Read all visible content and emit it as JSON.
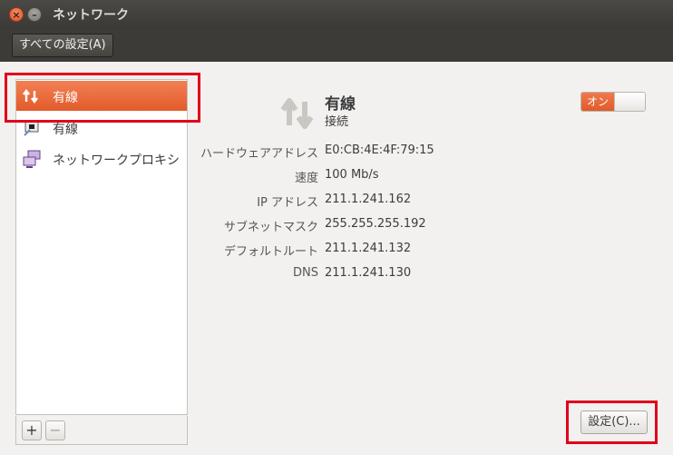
{
  "window": {
    "title": "ネットワーク",
    "close_glyph": "×",
    "minimize_glyph": "–"
  },
  "toolbar": {
    "all_settings_label": "すべての設定(A)"
  },
  "sidebar": {
    "items": [
      {
        "label": "有線",
        "icon": "wired-network-icon",
        "selected": true
      },
      {
        "label": "有線",
        "icon": "wired-adapter-icon",
        "selected": false
      },
      {
        "label": "ネットワークプロキシ",
        "icon": "network-proxy-icon",
        "selected": false
      }
    ],
    "add_label": "+",
    "remove_label": "−"
  },
  "detail": {
    "name": "有線",
    "status": "接続",
    "toggle_label": "オン",
    "toggle_on": true,
    "rows": [
      {
        "key": "ハードウェアアドレス",
        "value": "E0:CB:4E:4F:79:15"
      },
      {
        "key": "速度",
        "value": "100 Mb/s"
      },
      {
        "key": "IP アドレス",
        "value": "211.1.241.162"
      },
      {
        "key": "サブネットマスク",
        "value": "255.255.255.192"
      },
      {
        "key": "デフォルトルート",
        "value": "211.1.241.132"
      },
      {
        "key": "DNS",
        "value": "211.1.241.130"
      }
    ],
    "configure_label": "設定(C)..."
  },
  "colors": {
    "accent": "#e25b2a",
    "highlight": "#e0001a"
  }
}
